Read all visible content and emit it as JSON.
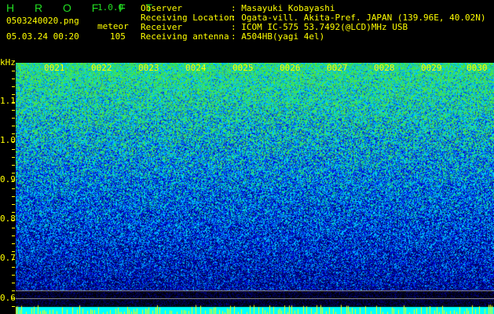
{
  "app": {
    "name": "H R O F F T",
    "version": "1.0.0"
  },
  "file": {
    "name": "0503240020.png",
    "datetime": "05.03.24 00:20"
  },
  "meteor": {
    "label": "meteor",
    "count": "105"
  },
  "info": [
    {
      "key": "Observer",
      "value": "Masayuki Kobayashi"
    },
    {
      "key": "Receiving Location",
      "value": "Ogata-vill. Akita-Pref. JAPAN (139.96E, 40.02N)"
    },
    {
      "key": "Receiver",
      "value": "ICOM IC-575 53.7492(@LCD)MHz USB"
    },
    {
      "key": "Receiving antenna",
      "value": "A504HB(yagi 4el)"
    }
  ],
  "y_axis": {
    "unit": "kHz",
    "labels": [
      "1.1",
      "1.0",
      "0.9",
      "0.8",
      "0.7",
      "0.6"
    ]
  },
  "x_axis": {
    "labels": [
      "0021",
      "0022",
      "0023",
      "0024",
      "0025",
      "0026",
      "0027",
      "0028",
      "0029",
      "0030"
    ]
  },
  "colors": {
    "text": "#ffff00",
    "title": "#22dd22",
    "bottom_bar": "#00ffff"
  }
}
